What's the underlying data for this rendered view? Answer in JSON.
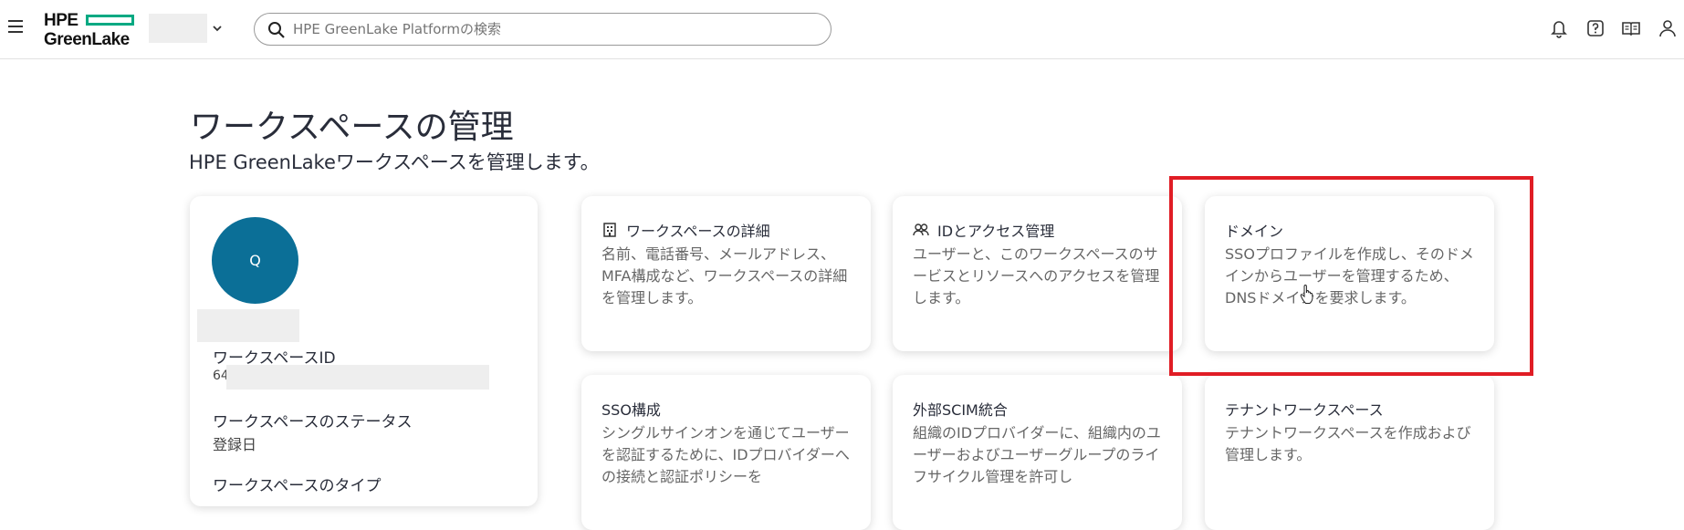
{
  "header": {
    "menu_icon": "hamburger-icon",
    "logo_top": "HPE",
    "logo_bottom": "GreenLake",
    "brand_color": "#01a982",
    "search": {
      "placeholder": "HPE GreenLake Platformの検索"
    },
    "right_icons": [
      "bell-icon",
      "help-icon",
      "docs-icon",
      "user-icon"
    ]
  },
  "page": {
    "title": "ワークスペースの管理",
    "subtitle": "HPE GreenLakeワークスペースを管理します。"
  },
  "profile": {
    "avatar_letter": "Q",
    "avatar_color": "#0b6f97",
    "workspace_id_label": "ワークスペースID",
    "workspace_id_value": "64",
    "status_label": "ワークスペースのステータス",
    "status_value": "登録日",
    "type_label": "ワークスペースのタイプ"
  },
  "tiles": [
    {
      "title": "ワークスペースの詳細",
      "icon": "building-icon",
      "desc": "名前、電話番号、メールアドレス、MFA構成など、ワークスペースの詳細を管理します。"
    },
    {
      "title": "IDとアクセス管理",
      "icon": "users-icon",
      "desc": "ユーザーと、このワークスペースのサービスとリソースへのアクセスを管理します。"
    },
    {
      "title": "ドメイン",
      "icon": "",
      "desc": "SSOプロファイルを作成し、そのドメインからユーザーを管理するため、DNSドメインを要求します。"
    },
    {
      "title": "SSO構成",
      "icon": "",
      "desc": "シングルサインオンを通じてユーザーを認証するために、IDプロバイダーへの接続と認証ポリシーを"
    },
    {
      "title": "外部SCIM統合",
      "icon": "",
      "desc": "組織のIDプロバイダーに、組織内のユーザーおよびユーザーグループのライフサイクル管理を許可し"
    },
    {
      "title": "テナントワークスペース",
      "icon": "",
      "desc": "テナントワークスペースを作成および管理します。"
    }
  ],
  "highlight_color": "#e01d25"
}
